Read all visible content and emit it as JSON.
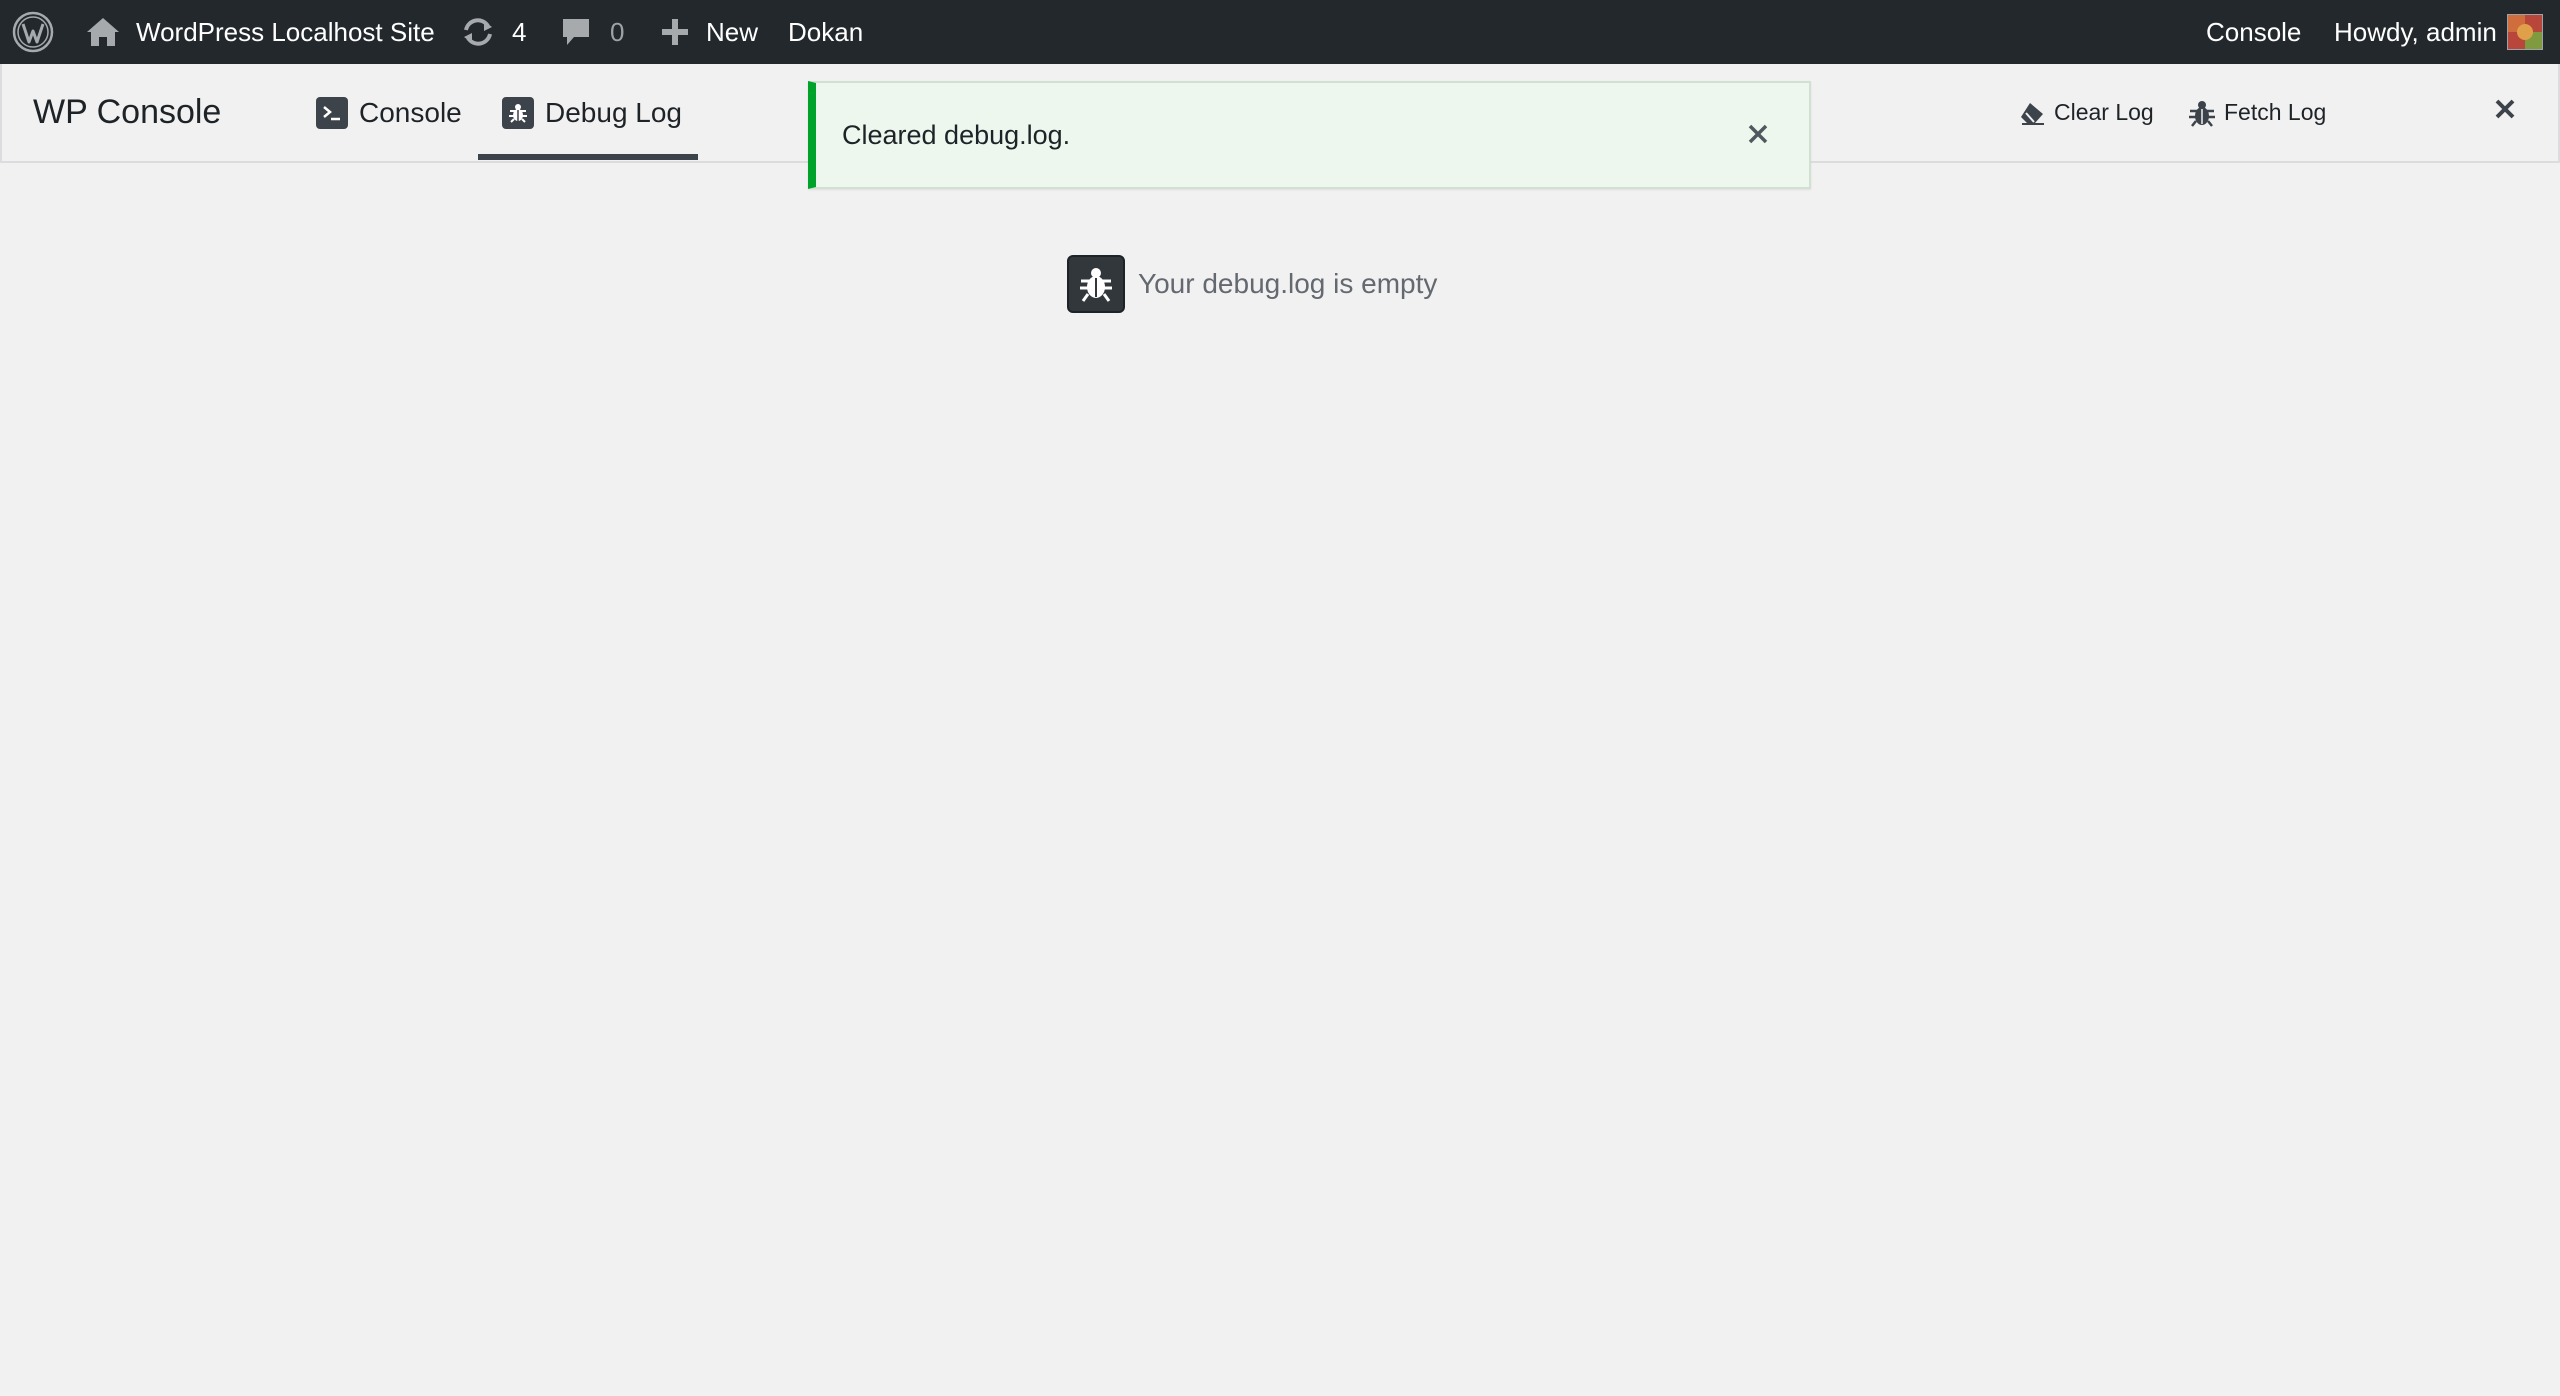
{
  "adminbar": {
    "site_name": "WordPress Localhost Site",
    "updates_count": "4",
    "comments_count": "0",
    "new_label": "New",
    "plugin_link": "Dokan",
    "console_link": "Console",
    "greeting": "Howdy, admin"
  },
  "panel": {
    "title": "WP Console",
    "tabs": [
      {
        "label": "Console",
        "icon": "terminal-icon"
      },
      {
        "label": "Debug Log",
        "icon": "bug-icon",
        "active": true
      }
    ],
    "clear_log_label": "Clear Log",
    "fetch_log_label": "Fetch Log"
  },
  "notice": {
    "message": "Cleared debug.log."
  },
  "empty_state": {
    "message": "Your debug.log is empty"
  },
  "colors": {
    "adminbar_bg": "#23282d",
    "notice_accent": "#00a32a",
    "notice_bg": "#edf7ee",
    "page_bg": "#f1f1f1"
  }
}
